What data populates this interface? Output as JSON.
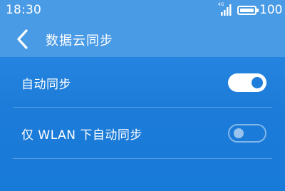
{
  "status_bar": {
    "time": "18:30",
    "network_label": "4G",
    "battery_level": "100"
  },
  "header": {
    "title": "数据云同步"
  },
  "settings": [
    {
      "label": "自动同步",
      "enabled": true
    },
    {
      "label": "仅 WLAN 下自动同步",
      "enabled": false
    }
  ],
  "colors": {
    "background": "#1f7ed9",
    "header": "#4a9be6",
    "toggle_knob_on": "#1f7ed9"
  }
}
